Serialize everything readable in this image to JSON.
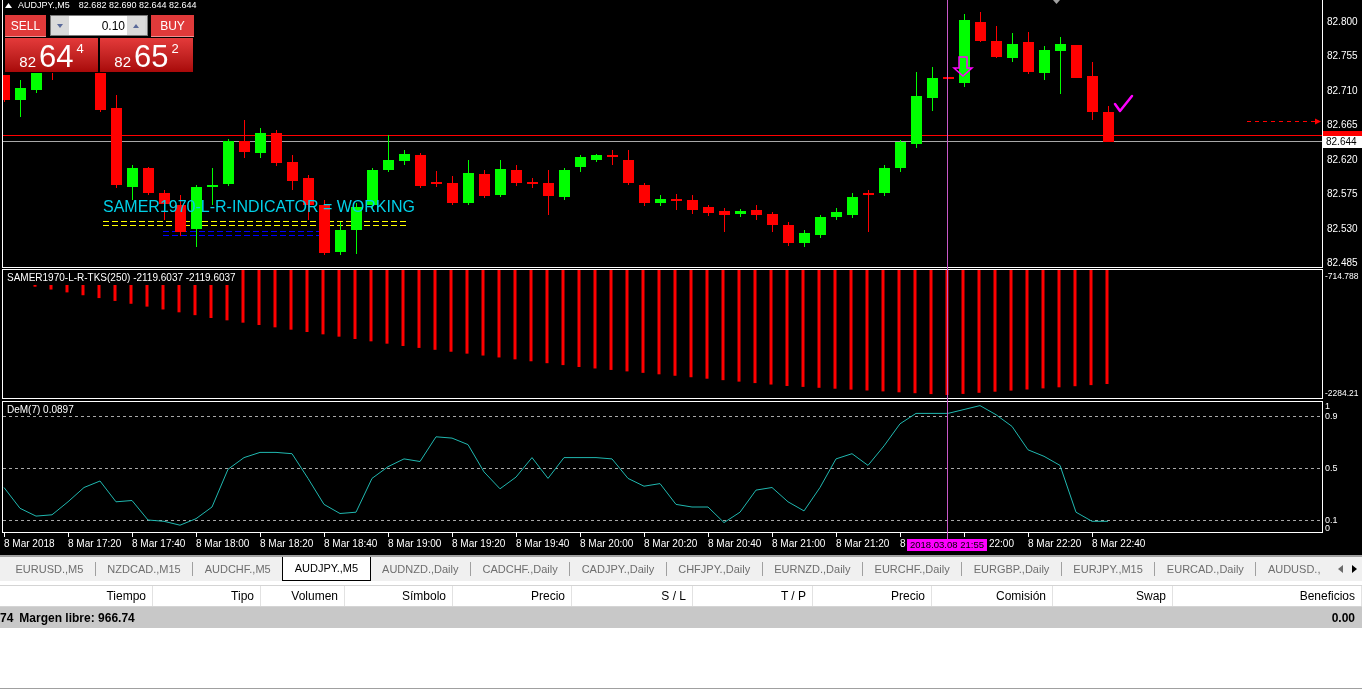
{
  "chart_window": {
    "symbol": "AUDJPY.,M5",
    "quotes": "82.682 82.690 82.644 82.644",
    "trade_panel": {
      "sell_label": "SELL",
      "buy_label": "BUY",
      "lot": "0.10",
      "sell_price": {
        "prefix": "82",
        "pips": "64",
        "fraction": "4"
      },
      "buy_price": {
        "prefix": "82",
        "pips": "65",
        "fraction": "2"
      }
    },
    "chart_text": "SAMER1970-L-R-INDICATOR = WORKING",
    "price_axis": {
      "labels": [
        "82.800",
        "82.755",
        "82.710",
        "82.665",
        "82.620",
        "82.575",
        "82.530",
        "82.485"
      ],
      "bid_tag": "82.644"
    },
    "histogram_panel": {
      "label": "SAMER1970-L-R-TKS(250) -2119.6037 -2119.6037",
      "axis_labels": [
        "-714.788",
        "-2284.21"
      ]
    },
    "dem_panel": {
      "label": "DeM(7) 0.0897",
      "chart_data": {
        "type": "line",
        "grid": true,
        "values": [
          0.35,
          0.19,
          0.13,
          0.14,
          0.24,
          0.35,
          0.4,
          0.24,
          0.25,
          0.1,
          0.09,
          0.06,
          0.11,
          0.2,
          0.49,
          0.58,
          0.62,
          0.62,
          0.61,
          0.42,
          0.22,
          0.15,
          0.16,
          0.42,
          0.51,
          0.57,
          0.55,
          0.74,
          0.73,
          0.68,
          0.47,
          0.34,
          0.43,
          0.58,
          0.42,
          0.58,
          0.58,
          0.58,
          0.57,
          0.42,
          0.36,
          0.38,
          0.22,
          0.2,
          0.2,
          0.08,
          0.16,
          0.33,
          0.35,
          0.24,
          0.17,
          0.35,
          0.57,
          0.61,
          0.52,
          0.67,
          0.84,
          0.92,
          0.92,
          0.92,
          0.95,
          0.98,
          0.91,
          0.82,
          0.64,
          0.59,
          0.52,
          0.16,
          0.09,
          0.09
        ],
        "ylim": [
          0,
          1
        ],
        "yticks": [
          {
            "value": 1,
            "label": "1"
          },
          {
            "value": 0.9,
            "label": "0.9"
          },
          {
            "value": 0.5,
            "label": "0.5"
          },
          {
            "value": 0.1,
            "label": "0.1"
          },
          {
            "value": 0,
            "label": "0"
          }
        ]
      }
    },
    "time_axis": {
      "labels": [
        {
          "text": "8 Mar 2018",
          "kind": "full"
        },
        {
          "text": "8 Mar 17:20",
          "kind": "full"
        },
        {
          "text": "8 Mar 17:40",
          "kind": "full"
        },
        {
          "text": "8 Mar 18:00",
          "kind": "full"
        },
        {
          "text": "8 Mar 18:20",
          "kind": "full"
        },
        {
          "text": "8 Mar 18:40",
          "kind": "full"
        },
        {
          "text": "8 Mar 19:00",
          "kind": "full"
        },
        {
          "text": "8 Mar 19:20",
          "kind": "full"
        },
        {
          "text": "8 Mar 19:40",
          "kind": "full"
        },
        {
          "text": "8 Mar 20:00",
          "kind": "full"
        },
        {
          "text": "8 Mar 20:20",
          "kind": "full"
        },
        {
          "text": "8 Mar 20:40",
          "kind": "full"
        },
        {
          "text": "8 Mar 21:00",
          "kind": "full"
        },
        {
          "text": "8 Mar 21:20",
          "kind": "full"
        },
        {
          "text": "8",
          "kind": "full"
        },
        {
          "text": "22:00",
          "kind": "tail"
        },
        {
          "text": "8 Mar 22:20",
          "kind": "full"
        },
        {
          "text": "8 Mar 22:40",
          "kind": "full"
        }
      ],
      "cursor_label": "2018.03.08 21:55"
    }
  },
  "tabs": [
    {
      "label": "EURUSD.,M5",
      "selected": false
    },
    {
      "label": "NZDCAD.,M15",
      "selected": false
    },
    {
      "label": "AUDCHF.,M5",
      "selected": false
    },
    {
      "label": "AUDJPY.,M5",
      "selected": true
    },
    {
      "label": "AUDNZD.,Daily",
      "selected": false
    },
    {
      "label": "CADCHF.,Daily",
      "selected": false
    },
    {
      "label": "CADJPY.,Daily",
      "selected": false
    },
    {
      "label": "CHFJPY.,Daily",
      "selected": false
    },
    {
      "label": "EURNZD.,Daily",
      "selected": false
    },
    {
      "label": "EURCHF.,Daily",
      "selected": false
    },
    {
      "label": "EURGBP.,Daily",
      "selected": false
    },
    {
      "label": "EURJPY.,M15",
      "selected": false
    },
    {
      "label": "EURCAD.,Daily",
      "selected": false
    },
    {
      "label": "AUDUSD.,",
      "selected": false
    }
  ],
  "trade_table": {
    "columns": [
      "Tiempo",
      "Tipo",
      "Volumen",
      "Símbolo",
      "Precio",
      "S / L",
      "T / P",
      "Precio",
      "Comisión",
      "Swap",
      "Beneficios"
    ],
    "summary": {
      "balance_tail": "74",
      "free_margin": "Margen libre: 966.74",
      "profit": "0.00"
    }
  }
}
